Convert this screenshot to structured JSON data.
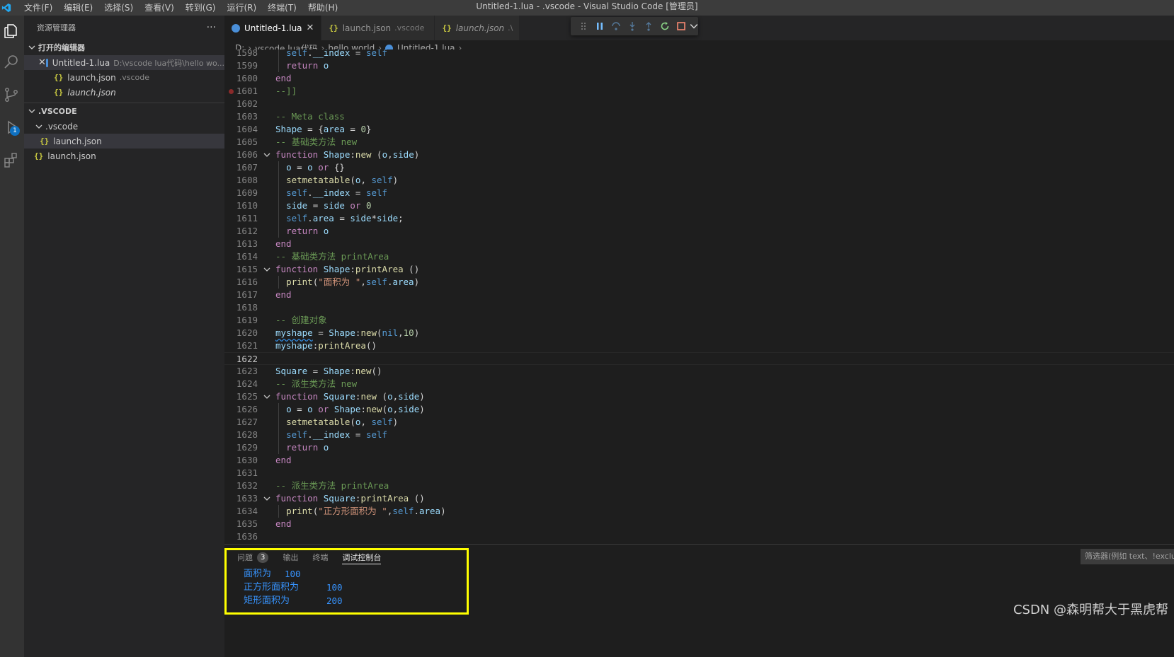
{
  "titlebar": {
    "menus": [
      "文件(F)",
      "编辑(E)",
      "选择(S)",
      "查看(V)",
      "转到(G)",
      "运行(R)",
      "终端(T)",
      "帮助(H)"
    ],
    "title": "Untitled-1.lua - .vscode - Visual Studio Code [管理员]"
  },
  "activitybar": {
    "debug_badge": "1"
  },
  "sidebar": {
    "header": "资源管理器",
    "more": "···",
    "open_editors_title": "打开的编辑器",
    "open_editors": [
      {
        "name": "Untitled-1.lua",
        "desc": "D:\\vscode lua代码\\hello wo..."
      },
      {
        "name": "launch.json",
        "desc": ".vscode"
      },
      {
        "name": "launch.json",
        "desc": ""
      }
    ],
    "folder_title": ".VSCODE",
    "subfolder": ".vscode",
    "files": [
      "launch.json",
      "launch.json"
    ]
  },
  "tabs": [
    {
      "name": "Untitled-1.lua",
      "desc": ""
    },
    {
      "name": "launch.json",
      "desc": ".vscode"
    },
    {
      "name": "launch.json",
      "desc": ".\\"
    }
  ],
  "breadcrumb": [
    "D:",
    "vscode lua代码",
    "hello world",
    "Untitled-1.lua",
    "..."
  ],
  "panel": {
    "tabs": [
      "问题",
      "输出",
      "终端",
      "调试控制台"
    ],
    "problems_count": "3",
    "filter_placeholder": "筛选器(例如 text、!exclu",
    "output": [
      {
        "label": "面积为",
        "value": "100"
      },
      {
        "label": "正方形面积为",
        "value": "100"
      },
      {
        "label": "矩形面积为",
        "value": "200"
      }
    ]
  },
  "watermark": "CSDN @森明帮大于黑虎帮",
  "code": {
    "line_numbers": [
      "1598",
      "1599",
      "1600",
      "1601",
      "1602",
      "1603",
      "1604",
      "1605",
      "1606",
      "1607",
      "1608",
      "1609",
      "1610",
      "1611",
      "1612",
      "1613",
      "1614",
      "1615",
      "1616",
      "1617",
      "1618",
      "1619",
      "1620",
      "1621",
      "1622",
      "1623",
      "1624",
      "1625",
      "1626",
      "1627",
      "1628",
      "1629",
      "1630",
      "1631",
      "1632",
      "1633",
      "1634",
      "1635",
      "1636"
    ],
    "current_line": "1622",
    "breakpoint_line": "1601"
  }
}
